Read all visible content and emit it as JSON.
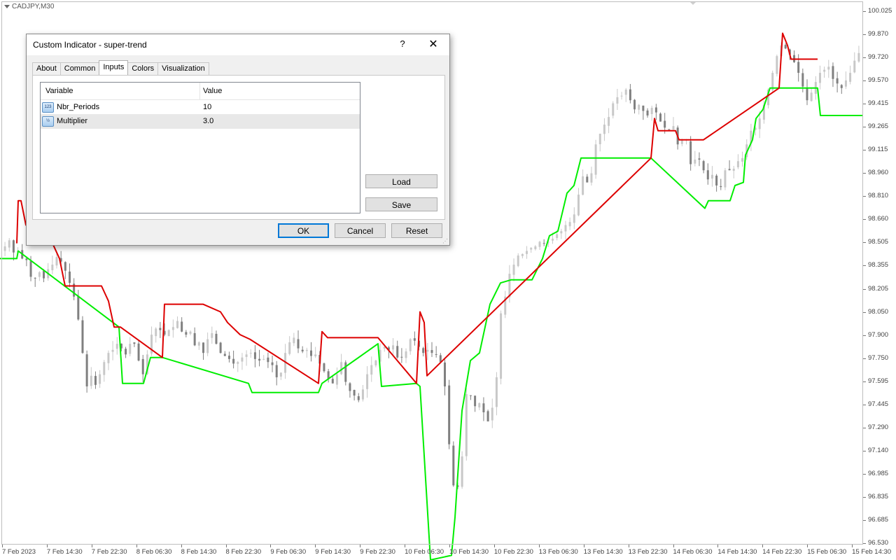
{
  "chart": {
    "symbol": "CADJPY,M30",
    "y_ticks": [
      "100.025",
      "99.870",
      "99.720",
      "99.570",
      "99.415",
      "99.265",
      "99.115",
      "98.960",
      "98.810",
      "98.660",
      "98.505",
      "98.355",
      "98.205",
      "98.050",
      "97.900",
      "97.750",
      "97.595",
      "97.445",
      "97.290",
      "97.140",
      "96.985",
      "96.835",
      "96.685",
      "96.530"
    ],
    "x_ticks": [
      "7 Feb 2023",
      "7 Feb 14:30",
      "7 Feb 22:30",
      "8 Feb 06:30",
      "8 Feb 14:30",
      "8 Feb 22:30",
      "9 Feb 06:30",
      "9 Feb 14:30",
      "9 Feb 22:30",
      "10 Feb 06:30",
      "10 Feb 14:30",
      "10 Feb 22:30",
      "13 Feb 06:30",
      "13 Feb 14:30",
      "13 Feb 22:30",
      "14 Feb 06:30",
      "14 Feb 14:30",
      "14 Feb 22:30",
      "15 Feb 06:30",
      "15 Feb 14:30"
    ],
    "colors": {
      "up_trend": "#00ee00",
      "down_trend": "#dd0000",
      "candle_bull": "#c8c8c8",
      "candle_bear": "#808080"
    },
    "supertrend_up": [
      [
        0,
        98.4
      ],
      [
        24,
        98.4
      ],
      [
        26,
        98.45
      ],
      [
        170,
        97.95
      ],
      [
        175,
        97.58
      ],
      [
        205,
        97.58
      ],
      [
        215,
        97.75
      ],
      [
        232,
        97.75
      ],
      [
        355,
        97.58
      ],
      [
        360,
        97.52
      ],
      [
        455,
        97.52
      ],
      [
        460,
        97.58
      ],
      [
        540,
        97.84
      ],
      [
        545,
        97.56
      ],
      [
        595,
        97.58
      ],
      [
        600,
        97.56
      ],
      [
        615,
        96.42
      ],
      [
        645,
        96.45
      ],
      [
        650,
        96.7
      ],
      [
        660,
        97.4
      ],
      [
        672,
        97.73
      ],
      [
        685,
        97.78
      ],
      [
        700,
        98.1
      ],
      [
        715,
        98.24
      ],
      [
        730,
        98.26
      ],
      [
        760,
        98.26
      ],
      [
        775,
        98.4
      ],
      [
        785,
        98.55
      ],
      [
        797,
        98.58
      ],
      [
        810,
        98.83
      ],
      [
        820,
        98.88
      ],
      [
        830,
        99.06
      ],
      [
        870,
        99.06
      ],
      [
        930,
        99.06
      ],
      [
        1007,
        98.73
      ],
      [
        1012,
        98.78
      ],
      [
        1043,
        98.78
      ],
      [
        1050,
        98.88
      ],
      [
        1062,
        98.9
      ],
      [
        1065,
        99.08
      ],
      [
        1075,
        99.18
      ],
      [
        1080,
        99.32
      ],
      [
        1090,
        99.38
      ],
      [
        1100,
        99.52
      ],
      [
        1113,
        99.52
      ],
      [
        1168,
        99.52
      ],
      [
        1172,
        99.34
      ],
      [
        1232,
        99.34
      ]
    ],
    "supertrend_down": [
      [
        24,
        98.5
      ],
      [
        26,
        98.78
      ],
      [
        30,
        98.78
      ],
      [
        37,
        98.62
      ],
      [
        60,
        98.62
      ],
      [
        75,
        98.5
      ],
      [
        85,
        98.4
      ],
      [
        93,
        98.22
      ],
      [
        145,
        98.22
      ],
      [
        155,
        98.12
      ],
      [
        163,
        97.95
      ],
      [
        172,
        97.95
      ],
      [
        232,
        97.75
      ],
      [
        235,
        98.1
      ],
      [
        290,
        98.1
      ],
      [
        315,
        98.05
      ],
      [
        325,
        97.98
      ],
      [
        343,
        97.9
      ],
      [
        357,
        97.87
      ],
      [
        455,
        97.58
      ],
      [
        460,
        97.92
      ],
      [
        468,
        97.88
      ],
      [
        540,
        97.88
      ],
      [
        595,
        97.58
      ],
      [
        600,
        98.05
      ],
      [
        606,
        97.98
      ],
      [
        610,
        97.63
      ],
      [
        930,
        99.06
      ],
      [
        935,
        99.32
      ],
      [
        940,
        99.24
      ],
      [
        965,
        99.24
      ],
      [
        970,
        99.18
      ],
      [
        1005,
        99.18
      ],
      [
        1113,
        99.52
      ],
      [
        1118,
        99.88
      ],
      [
        1125,
        99.8
      ],
      [
        1130,
        99.71
      ],
      [
        1168,
        99.71
      ]
    ],
    "closes": [
      98.48,
      98.52,
      98.44,
      98.45,
      98.4,
      98.39,
      98.28,
      98.27,
      98.31,
      98.27,
      98.33,
      98.36,
      98.41,
      98.38,
      98.32,
      98.24,
      98.15,
      98.0,
      97.78,
      97.56,
      97.63,
      97.57,
      97.64,
      97.72,
      97.78,
      97.8,
      97.84,
      97.81,
      97.77,
      97.84,
      97.84,
      97.73,
      97.64,
      97.77,
      97.9,
      97.94,
      97.93,
      97.9,
      97.93,
      97.95,
      97.99,
      97.92,
      97.9,
      97.92,
      97.83,
      97.85,
      97.78,
      97.87,
      97.91,
      97.84,
      97.78,
      97.76,
      97.74,
      97.71,
      97.72,
      97.75,
      97.77,
      97.78,
      97.74,
      97.73,
      97.74,
      97.72,
      97.7,
      97.62,
      97.65,
      97.78,
      97.85,
      97.88,
      97.81,
      97.79,
      97.8,
      97.76,
      97.77,
      97.71,
      97.66,
      97.61,
      97.58,
      97.64,
      97.72,
      97.59,
      97.53,
      97.5,
      97.47,
      97.54,
      97.64,
      97.7,
      97.73,
      97.8,
      97.82,
      97.8,
      97.83,
      97.75,
      97.75,
      97.79,
      97.87,
      97.86,
      97.82,
      97.78,
      97.8,
      97.78,
      97.77,
      97.72,
      97.56,
      97.18,
      96.91,
      96.9,
      97.1,
      97.51,
      97.5,
      97.43,
      97.45,
      97.39,
      97.33,
      97.42,
      97.62,
      98.04,
      98.15,
      98.3,
      98.36,
      98.42,
      98.43,
      98.45,
      98.47,
      98.48,
      98.51,
      98.5,
      98.51,
      98.53,
      98.56,
      98.58,
      98.62,
      98.64,
      98.69,
      98.82,
      98.94,
      98.9,
      98.96,
      99.15,
      99.22,
      99.28,
      99.33,
      99.42,
      99.46,
      99.47,
      99.51,
      99.44,
      99.38,
      99.41,
      99.37,
      99.34,
      99.39,
      99.36,
      99.3,
      99.26,
      99.25,
      99.27,
      99.15,
      99.18,
      99.18,
      99.02,
      99.05,
      99.05,
      98.98,
      98.92,
      98.95,
      98.88,
      98.87,
      98.98,
      98.98,
      98.99,
      99.04,
      99.06,
      99.15,
      99.24,
      99.26,
      99.32,
      99.41,
      99.51,
      99.62,
      99.73,
      99.8,
      99.78,
      99.74,
      99.69,
      99.62,
      99.53,
      99.44,
      99.49,
      99.56,
      99.62,
      99.64,
      99.66,
      99.58,
      99.55,
      99.52,
      99.57,
      99.62,
      99.7,
      99.75
    ]
  },
  "dialog": {
    "title": "Custom Indicator - super-trend",
    "help_glyph": "?",
    "close_glyph": "✕",
    "tabs": [
      "About",
      "Common",
      "Inputs",
      "Colors",
      "Visualization"
    ],
    "active_tab": "Inputs",
    "columns": {
      "variable": "Variable",
      "value": "Value"
    },
    "rows": [
      {
        "icon": "123",
        "name": "Nbr_Periods",
        "value": "10"
      },
      {
        "icon": "½",
        "name": "Multiplier",
        "value": "3.0"
      }
    ],
    "load_label": "Load",
    "save_label": "Save",
    "ok_label": "OK",
    "cancel_label": "Cancel",
    "reset_label": "Reset"
  }
}
